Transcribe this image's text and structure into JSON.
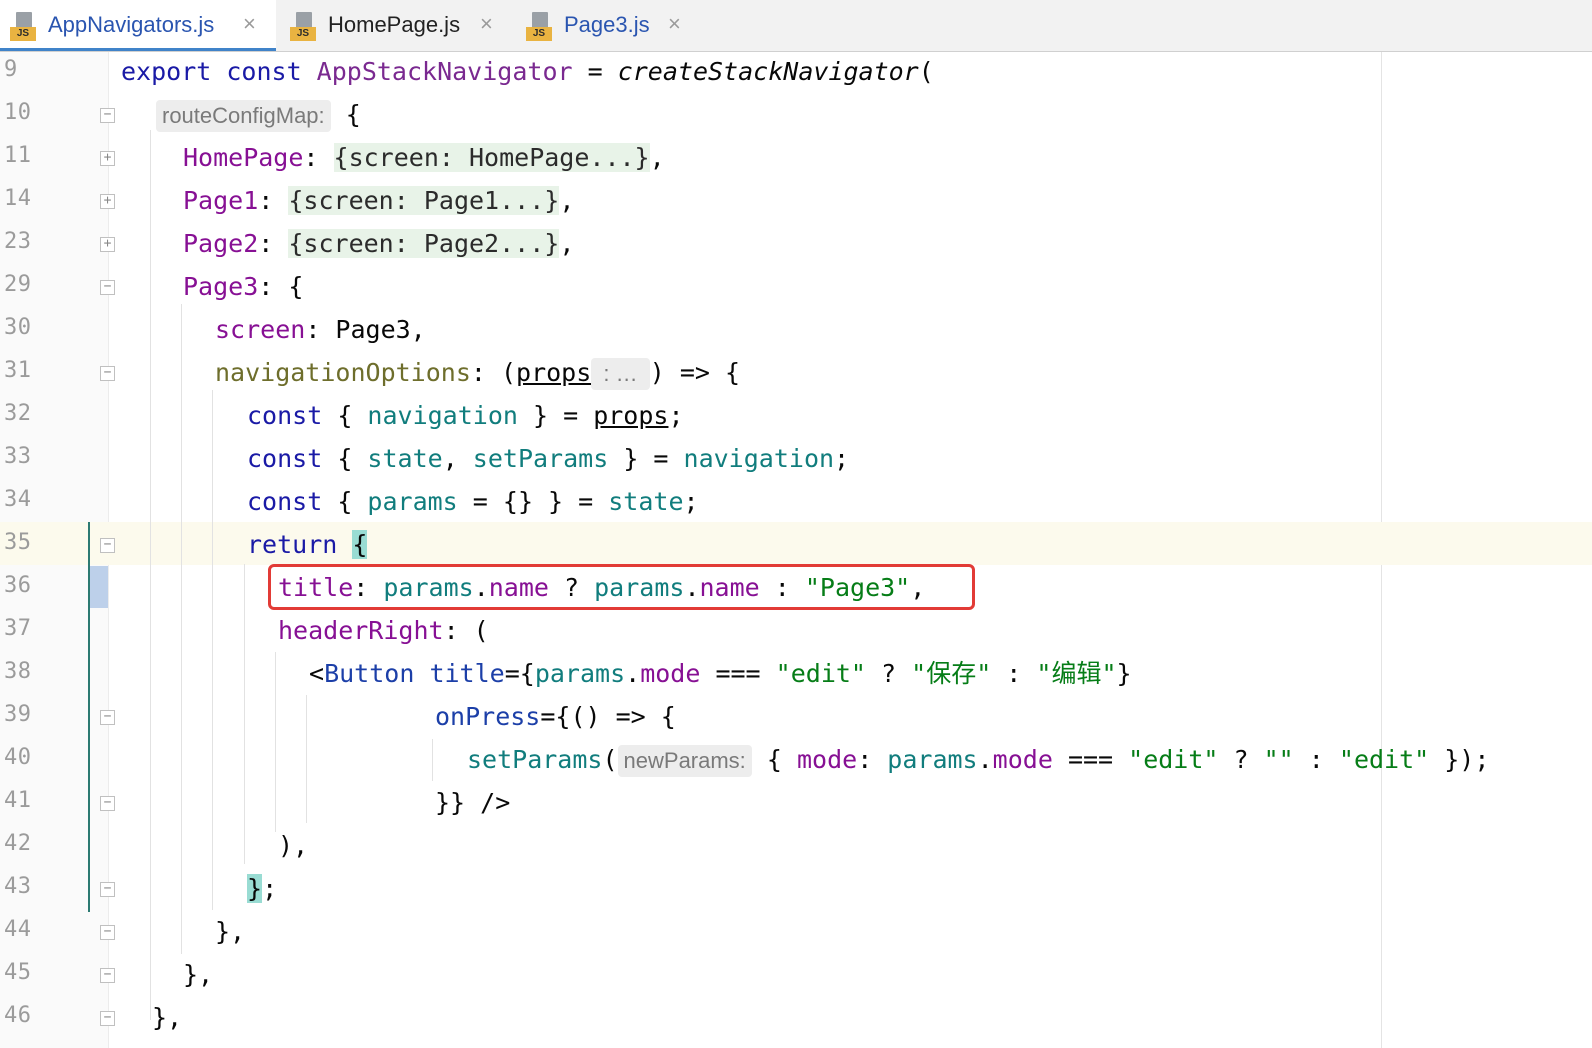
{
  "tabs": [
    {
      "label": "AppNavigators.js",
      "icon": "js-file-icon",
      "active": true
    },
    {
      "label": "HomePage.js",
      "icon": "js-file-icon",
      "active": false
    },
    {
      "label": "Page3.js",
      "icon": "js-file-icon",
      "active": false
    }
  ],
  "close_glyph": "×",
  "js_badge": "JS",
  "line_numbers": [
    "9",
    "10",
    "11",
    "14",
    "23",
    "29",
    "30",
    "31",
    "32",
    "33",
    "34",
    "35",
    "36",
    "37",
    "38",
    "39",
    "40",
    "41",
    "42",
    "43",
    "44",
    "45",
    "46"
  ],
  "code": {
    "l9": {
      "kw": "export const ",
      "name": "AppStackNavigator",
      "eq": " = ",
      "call": "createStackNavigator",
      "open": "("
    },
    "l10": {
      "hint": "routeConfigMap:",
      "rest": " {"
    },
    "l11": {
      "key": "HomePage",
      "colon": ": ",
      "folded": "{screen: HomePage...}",
      "end": ","
    },
    "l14": {
      "key": "Page1",
      "colon": ": ",
      "folded": "{screen: Page1...}",
      "end": ","
    },
    "l23": {
      "key": "Page2",
      "colon": ": ",
      "folded": "{screen: Page2...}",
      "end": ","
    },
    "l29": {
      "key": "Page3",
      "rest": ": {"
    },
    "l30": {
      "key": "screen",
      "rest": ": Page3,"
    },
    "l31": {
      "key": "navigationOptions",
      "mid": ": (",
      "arg": "props",
      "hint": " : … ",
      "rest": ") => {"
    },
    "l32": {
      "kw": "const",
      "a": " { ",
      "v": "navigation",
      "b": " } = ",
      "arg": "props",
      "end": ";"
    },
    "l33": {
      "kw": "const",
      "a": " { ",
      "v1": "state",
      "c": ", ",
      "v2": "setParams",
      "b": " } = ",
      "v3": "navigation",
      "end": ";"
    },
    "l34": {
      "kw": "const",
      "a": " { ",
      "v": "params",
      "b": " = {} } = ",
      "v2": "state",
      "end": ";"
    },
    "l35": {
      "kw": "return",
      "sp": " ",
      "brace": "{"
    },
    "l36": {
      "key": "title",
      "colon": ": ",
      "v1": "params",
      "d1": ".",
      "p1": "name",
      "q": " ? ",
      "v2": "params",
      "d2": ".",
      "p2": "name",
      "c": " : ",
      "s": "\"Page3\"",
      "end": ","
    },
    "l37": {
      "key": "headerRight",
      "rest": ": ("
    },
    "l38": {
      "lt": "<",
      "tag": "Button",
      "sp": " ",
      "attr": "title",
      "eq": "={",
      "v": "params",
      "d": ".",
      "p": "mode",
      "op": " === ",
      "s1": "\"edit\"",
      "q": " ? ",
      "s2": "\"保存\"",
      "c": " : ",
      "s3": "\"编辑\"",
      "end": "}"
    },
    "l39": {
      "attr": "onPress",
      "rest": "={() => {"
    },
    "l40": {
      "fn": "setParams",
      "open": "(",
      "hint": "newParams:",
      "a": " { ",
      "key": "mode",
      "colon": ": ",
      "v": "params",
      "d": ".",
      "p": "mode",
      "op": " === ",
      "s1": "\"edit\"",
      "q": " ? ",
      "s2": "\"\"",
      "c": " : ",
      "s3": "\"edit\"",
      "end": " });"
    },
    "l41": {
      "text": "}} />"
    },
    "l42": {
      "text": "),"
    },
    "l43": {
      "brace": "}",
      "end": ";"
    },
    "l44": {
      "text": "},"
    },
    "l45": {
      "text": "},"
    },
    "l46": {
      "text": "},"
    }
  }
}
